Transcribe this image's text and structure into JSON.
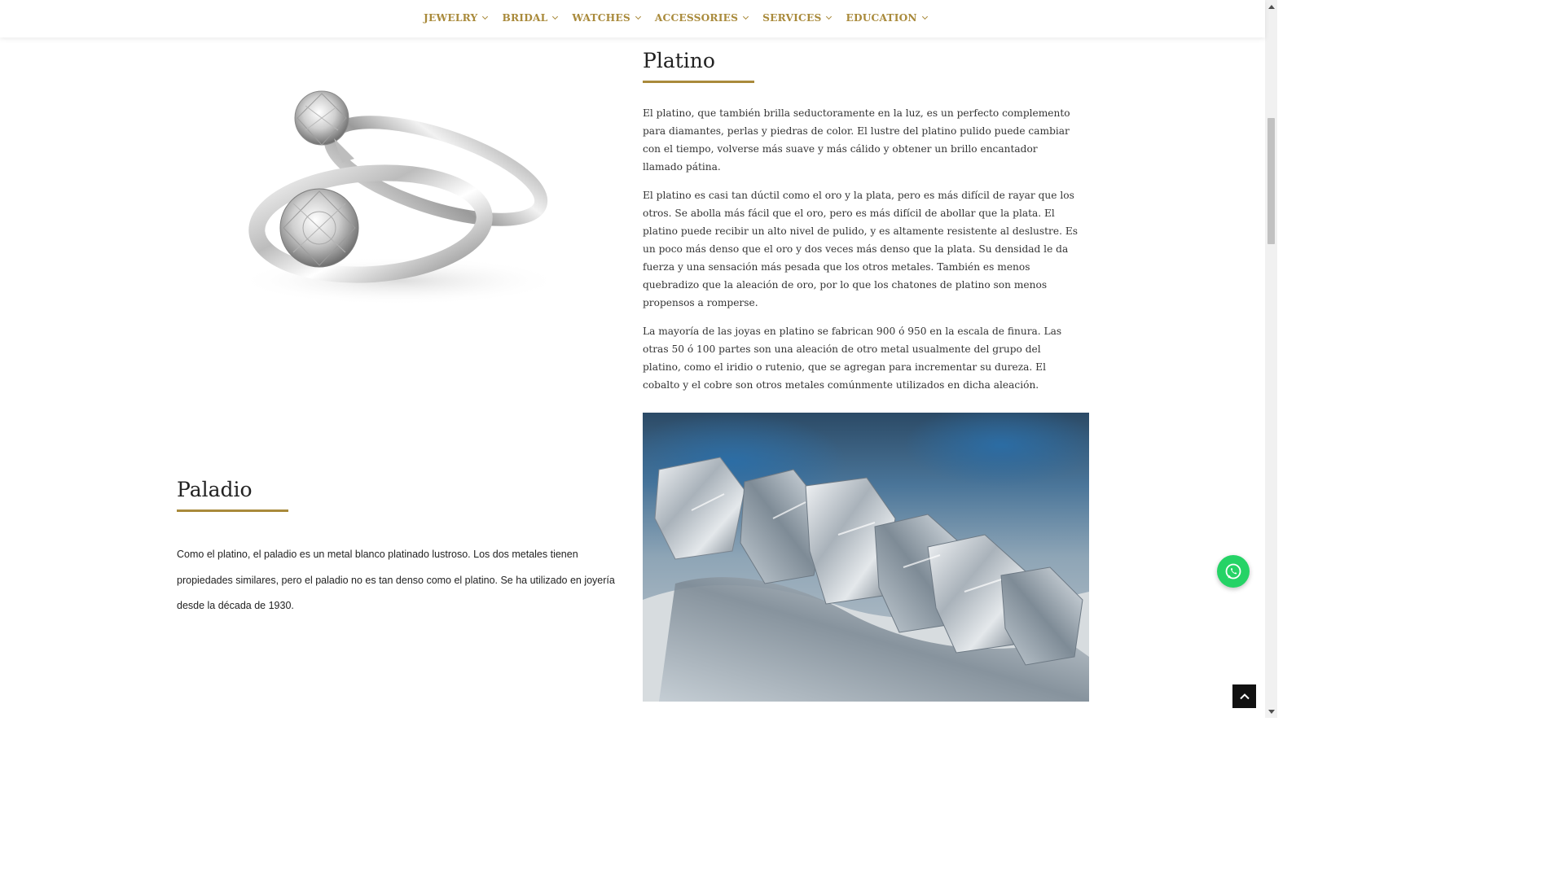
{
  "nav": {
    "items": [
      {
        "label": "JEWELRY"
      },
      {
        "label": "BRIDAL"
      },
      {
        "label": "WATCHES"
      },
      {
        "label": "ACCESSORIES"
      },
      {
        "label": "SERVICES"
      },
      {
        "label": "EDUCATION"
      }
    ]
  },
  "platino": {
    "title": "Platino",
    "paragraphs": [
      "El platino, que también brilla seductoramente en la luz, es un perfecto complemento para diamantes, perlas y piedras de color. El lustre del platino pulido puede cambiar con el tiempo, volverse más suave y más cálido y obtener un brillo encantador llamado pátina.",
      "El platino es casi tan dúctil como el oro y la plata, pero es más difícil de rayar que los otros. Se abolla más fácil que el oro, pero es más difícil de abollar que la plata. El platino puede recibir un alto nivel de pulido, y es altamente resistente al deslustre. Es un poco más denso que el oro y dos veces más denso que la plata. Su densidad le da fuerza y una sensación más pesada que los otros metales. También es menos quebradizo que la aleación de oro, por lo que los chatones de platino son menos propensos a romperse.",
      "La mayoría de las joyas en platino se fabrican 900 ó 950 en la escala de finura. Las otras 50 ó 100 partes son una aleación de otro metal usualmente del grupo del platino, como el iridio o rutenio, que se agregan para incrementar su dureza. El cobalto y el cobre son otros metales comúnmente utilizados en dicha aleación."
    ]
  },
  "paladio": {
    "title": "Paladio",
    "paragraph": "Como el platino, el paladio es un metal blanco platinado lustroso. Los dos metales tienen propiedades similares, pero el paladio no es tan denso como el platino. Se ha utilizado en joyería desde la década de 1930."
  },
  "colors": {
    "accent": "#a98a3b",
    "whatsapp": "#25d366"
  },
  "icons": {
    "whatsapp": "whatsapp-icon",
    "back_to_top": "chevron-up-icon"
  }
}
